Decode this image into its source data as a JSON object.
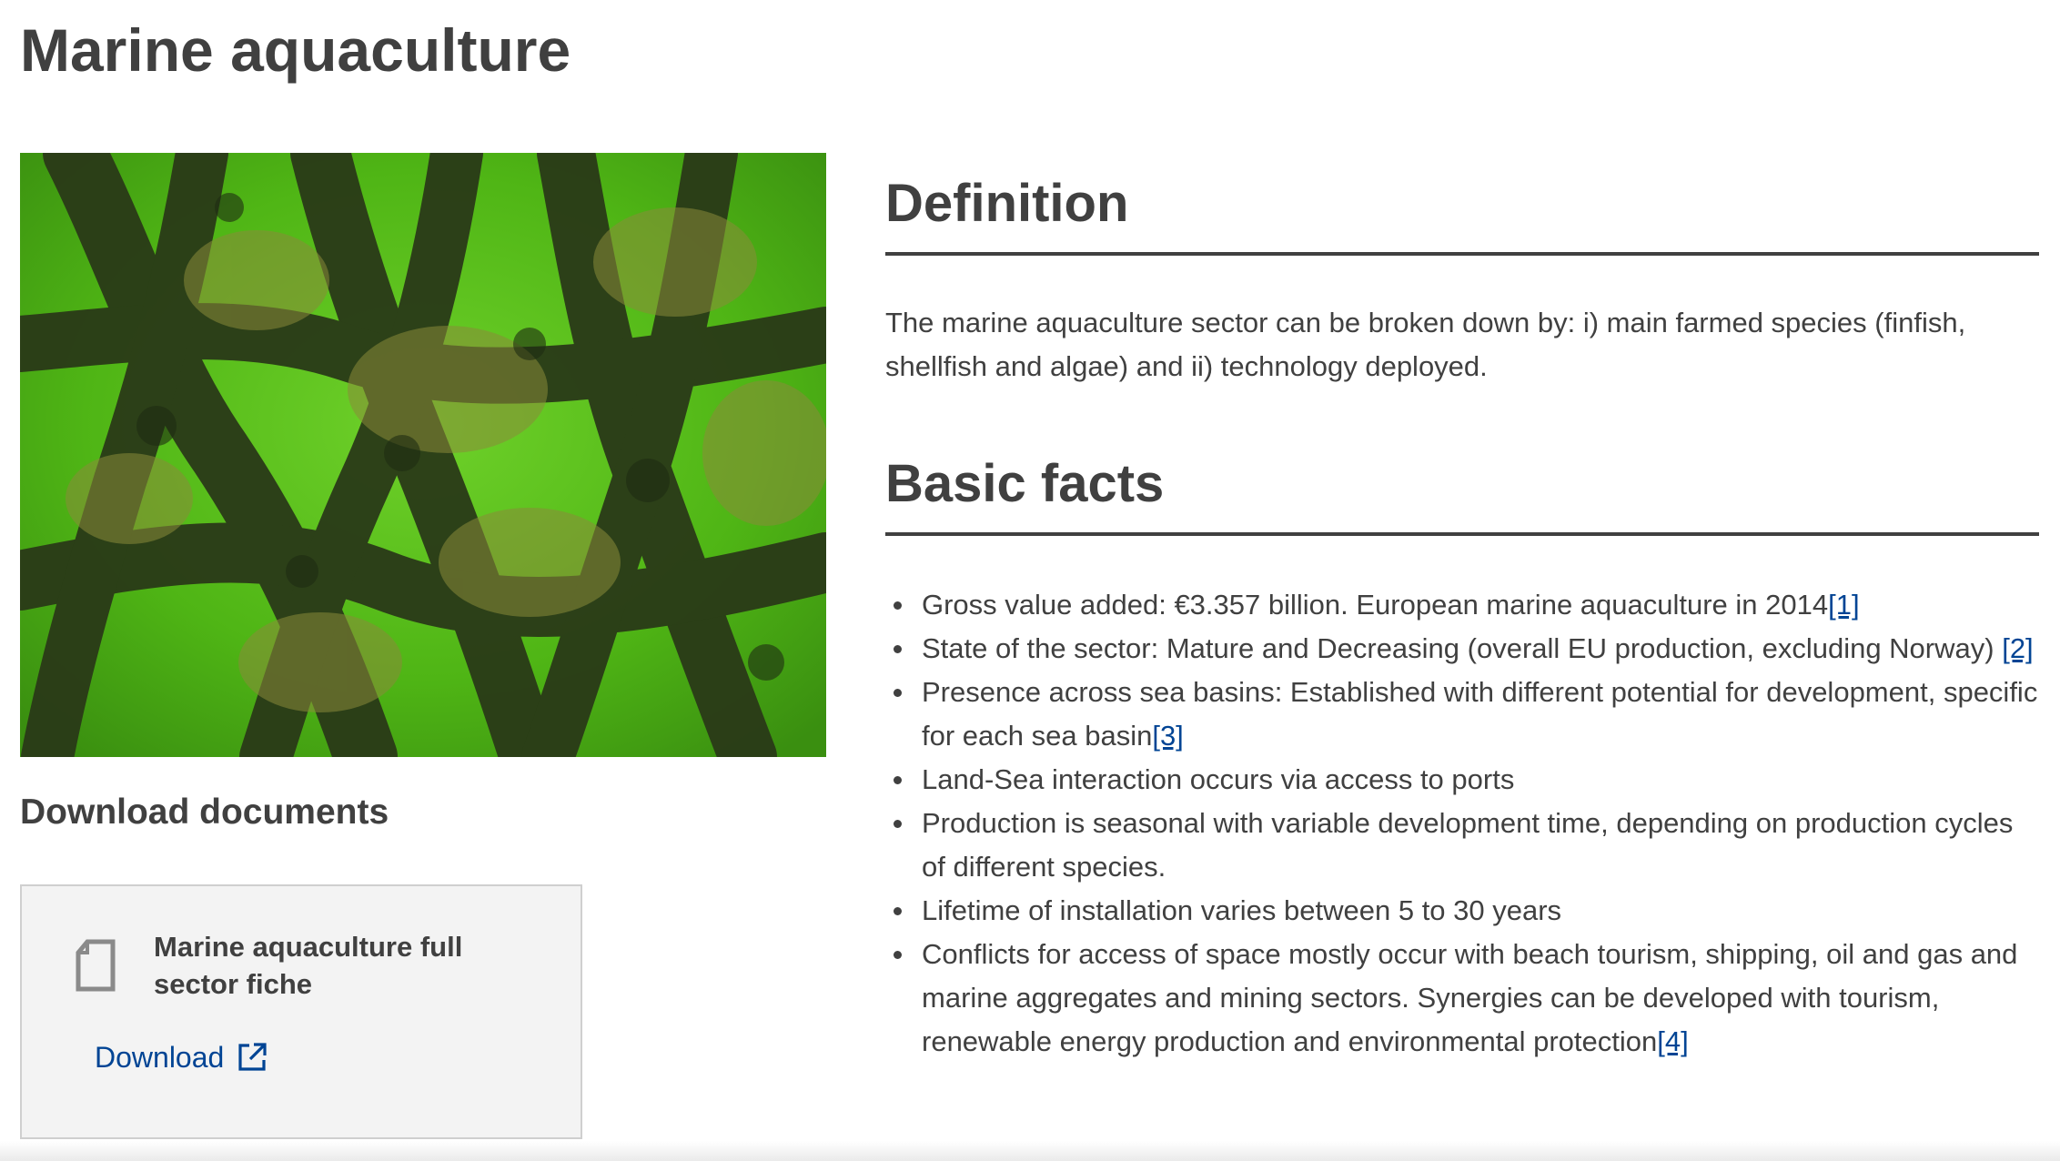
{
  "page": {
    "title": "Marine aquaculture"
  },
  "left": {
    "image_alt": "Underwater photo of mussels and algae growing on aquaculture ropes",
    "downloads_heading": "Download documents",
    "document": {
      "title": "Marine aquaculture full sector fiche",
      "icon": "document-icon",
      "download_label": "Download",
      "download_icon": "external-link-icon"
    }
  },
  "definition": {
    "heading": "Definition",
    "text": "The marine aquaculture sector can be broken down by: i) main farmed species (finfish, shellfish and algae) and ii) technology deployed."
  },
  "basic_facts": {
    "heading": "Basic facts",
    "items": [
      {
        "text": "Gross value added: €3.357 billion. European marine aquaculture in 2014",
        "ref": "[1]"
      },
      {
        "text": "State of the sector: Mature and Decreasing (overall EU production, excluding Norway) ",
        "ref": "[2]"
      },
      {
        "text": "Presence across sea basins: Established with different potential for development, specific for each sea basin",
        "ref": "[3]"
      },
      {
        "text": "Land-Sea interaction occurs via access to ports",
        "ref": ""
      },
      {
        "text": "Production is seasonal with variable development time, depending on production cycles of different species.",
        "ref": ""
      },
      {
        "text": "Lifetime of installation varies between 5 to 30 years",
        "ref": ""
      },
      {
        "text": "Conflicts for access of space mostly occur with beach tourism, shipping, oil and gas and marine aggregates and mining sectors. Synergies can be developed with tourism, renewable energy production and environmental protection",
        "ref": "[4]"
      }
    ]
  },
  "colors": {
    "text": "#404040",
    "link": "#004494",
    "card_bg": "#f3f3f3",
    "card_border": "#cfcfcf",
    "water_green": "#4fb515"
  }
}
